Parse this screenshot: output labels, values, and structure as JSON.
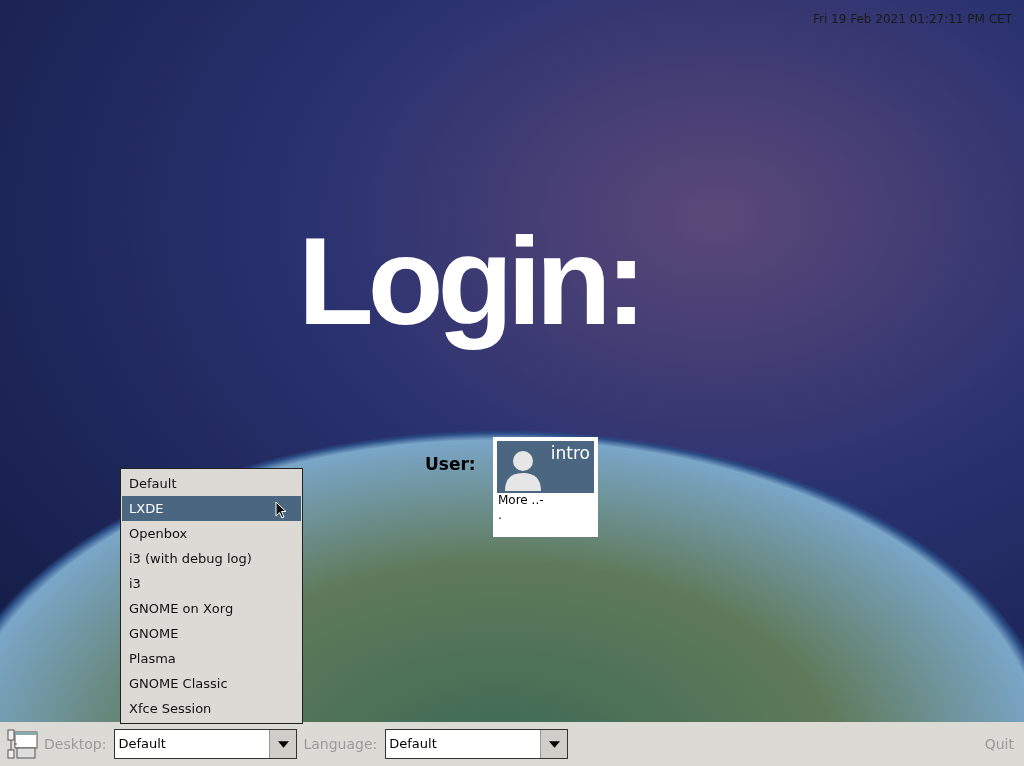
{
  "clock": "Fri 19 Feb 2021 01:27:11 PM CET",
  "title": "Login:",
  "user_label": "User:",
  "user_card": {
    "name": "intro",
    "lines": [
      "More ..-",
      "."
    ]
  },
  "session_menu": [
    {
      "label": "Default",
      "selected": false
    },
    {
      "label": "LXDE",
      "selected": true
    },
    {
      "label": "Openbox",
      "selected": false
    },
    {
      "label": "i3 (with debug log)",
      "selected": false
    },
    {
      "label": "i3",
      "selected": false
    },
    {
      "label": "GNOME on Xorg",
      "selected": false
    },
    {
      "label": "GNOME",
      "selected": false
    },
    {
      "label": "Plasma",
      "selected": false
    },
    {
      "label": "GNOME Classic",
      "selected": false
    },
    {
      "label": "Xfce Session",
      "selected": false
    }
  ],
  "bottom_bar": {
    "desktop_label": "Desktop:",
    "desktop_value": "Default",
    "language_label": "Language:",
    "language_value": "Default",
    "quit": {
      "label": "Quit",
      "disabled": true
    }
  }
}
